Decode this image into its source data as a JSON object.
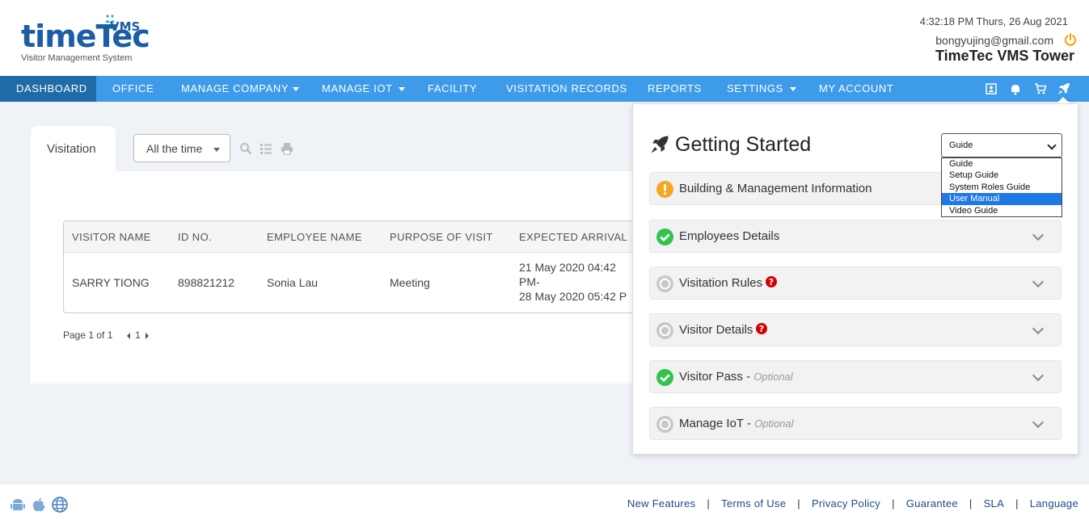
{
  "app": {
    "logo_text": "timeTec",
    "logo_badge": "VMS",
    "logo_subtitle": "Visitor Management System"
  },
  "header": {
    "datetime": "4:32:18 PM  Thurs, 26 Aug 2021",
    "email": "bongyujing@gmail.com",
    "company": "TimeTec VMS Tower",
    "power_icon": "power-icon"
  },
  "nav": {
    "items": [
      {
        "label": "DASHBOARD",
        "active": true
      },
      {
        "label": "OFFICE"
      },
      {
        "label": "MANAGE COMPANY",
        "dropdown": true
      },
      {
        "label": "MANAGE IOT",
        "dropdown": true
      },
      {
        "label": "FACILITY"
      },
      {
        "label": "VISITATION RECORDS"
      },
      {
        "label": "REPORTS"
      },
      {
        "label": "SETTINGS",
        "dropdown": true
      },
      {
        "label": "MY ACCOUNT"
      }
    ],
    "icons": [
      "contact-card-icon",
      "notification-icon",
      "cart-icon",
      "rocket-icon"
    ],
    "active_color": "#1f6ba5",
    "bar_color": "#3d9be9"
  },
  "visitation": {
    "tab_label": "Visitation",
    "filter_value": "All the time",
    "tools": [
      "search-icon",
      "list-icon",
      "print-icon"
    ],
    "columns": [
      "VISITOR NAME",
      "ID NO.",
      "EMPLOYEE NAME",
      "PURPOSE OF VISIT",
      "EXPECTED ARRIVAL"
    ],
    "rows": [
      {
        "visitor_name": "SARRY TIONG",
        "id_no": "898821212",
        "employee_name": "Sonia Lau",
        "purpose": "Meeting",
        "arrival_line1": "21 May 2020 04:42",
        "arrival_line2": "PM-",
        "arrival_line3": "28 May 2020 05:42 P"
      }
    ],
    "pager": {
      "text": "Page 1 of 1",
      "page": "1"
    }
  },
  "getting_started": {
    "title": "Getting Started",
    "guide_select_value": "Guide",
    "guide_options": [
      "Guide",
      "Setup Guide",
      "System Roles Guide",
      "User Manual",
      "Video Guide"
    ],
    "guide_highlighted": "User Manual",
    "steps": [
      {
        "label": "Building & Management Information",
        "status": "warning",
        "optional": "",
        "help": false
      },
      {
        "label": "Employees Details",
        "status": "done",
        "optional": "",
        "help": false
      },
      {
        "label": "Visitation Rules",
        "status": "pending",
        "optional": "",
        "help": true
      },
      {
        "label": "Visitor Details",
        "status": "pending",
        "optional": "",
        "help": true
      },
      {
        "label": "Visitor Pass - ",
        "status": "done",
        "optional": "Optional",
        "help": false
      },
      {
        "label": "Manage IoT - ",
        "status": "pending",
        "optional": "Optional",
        "help": false
      }
    ],
    "status_colors": {
      "warning": "#f5a623",
      "done": "#33c24d",
      "pending": "#c8c8c8"
    }
  },
  "footer": {
    "icons": [
      "android-icon",
      "apple-icon",
      "globe-icon"
    ],
    "links": [
      "New Features",
      "Terms of Use",
      "Privacy Policy",
      "Guarantee",
      "SLA",
      "Language"
    ],
    "separator": "|"
  }
}
